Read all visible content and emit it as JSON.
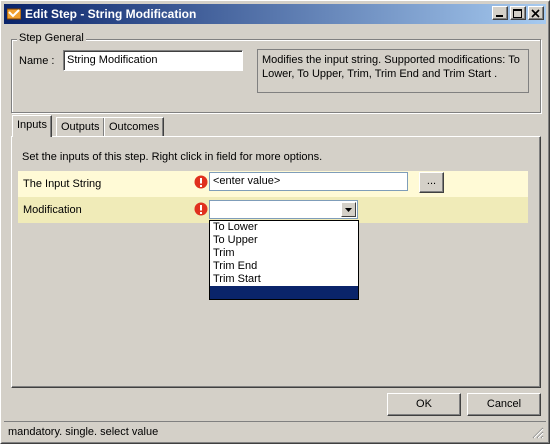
{
  "window": {
    "title": "Edit Step - String Modification",
    "icon": "app-icon",
    "controls": [
      "minimize-icon",
      "maximize-icon",
      "close-icon"
    ]
  },
  "step_general": {
    "legend": "Step General",
    "name_label": "Name :",
    "name_value": "String Modification",
    "description": "Modifies the input string. Supported modifications: To Lower, To Upper, Trim, Trim End and Trim Start ."
  },
  "tabs": [
    {
      "label": "Inputs",
      "active": true
    },
    {
      "label": "Outputs",
      "active": false
    },
    {
      "label": "Outcomes",
      "active": false
    }
  ],
  "inputs": {
    "instructions": "Set the inputs of this step.  Right click in field for more options.",
    "rows": [
      {
        "label": "The Input String",
        "value": "<enter value>",
        "button": "..."
      },
      {
        "label": "Modification",
        "value": ""
      }
    ],
    "dropdown_options": [
      "To Lower",
      "To Upper",
      "Trim",
      "Trim End",
      "Trim Start",
      ""
    ]
  },
  "buttons": {
    "ok": "OK",
    "cancel": "Cancel"
  },
  "status": "mandatory. single. select value",
  "colors": {
    "title_start": "#0a246a",
    "title_end": "#a6caf0",
    "row1_bg": "#fffad6",
    "row2_bg": "#f0ebb8",
    "mandatory": "#e0301e"
  }
}
